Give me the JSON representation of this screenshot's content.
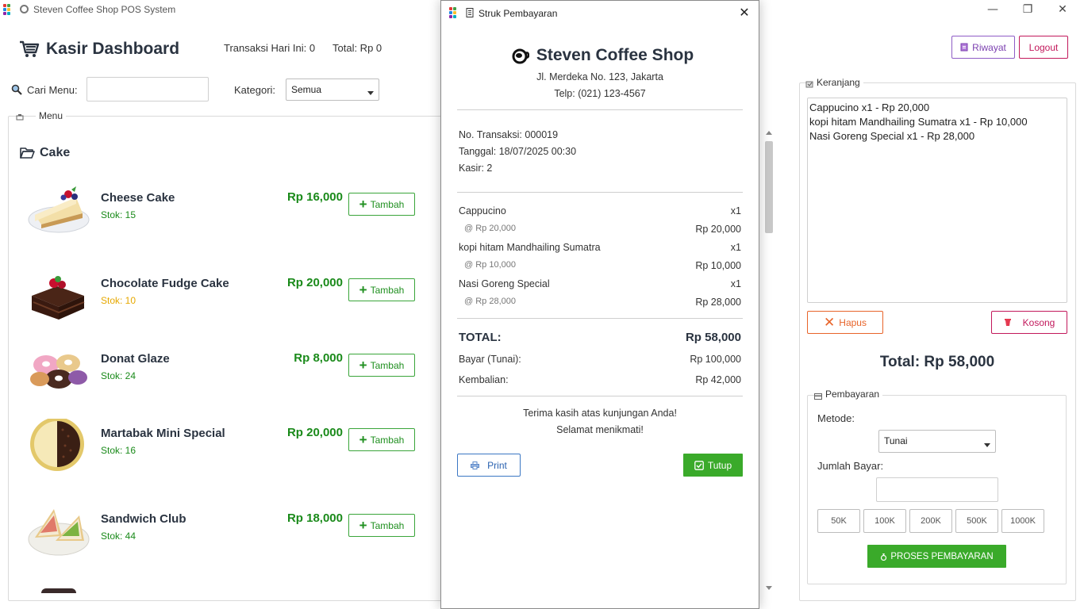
{
  "window": {
    "title": "Steven Coffee Shop POS System",
    "minimize_glyph": "—",
    "maximize_glyph": "❐",
    "close_glyph": "✕"
  },
  "header": {
    "title": "Kasir Dashboard",
    "transactions_today": "Transaksi Hari Ini: 0",
    "total_today": "Total: Rp 0",
    "history_button": "Riwayat",
    "logout_button": "Logout"
  },
  "search": {
    "label": "Cari Menu:",
    "value": "",
    "category_label": "Kategori:",
    "category_value": "Semua"
  },
  "menu": {
    "group_label": "Menu",
    "category_title": "Cake",
    "add_label": "Tambah",
    "items": [
      {
        "name": "Cheese Cake",
        "stock": "Stok: 15",
        "price": "Rp 16,000",
        "stock_color": "#1a8a1a"
      },
      {
        "name": "Chocolate Fudge Cake",
        "stock": "Stok: 10",
        "price": "Rp 20,000",
        "stock_color": "#e6a800"
      },
      {
        "name": "Donat Glaze",
        "stock": "Stok: 24",
        "price": "Rp 8,000",
        "stock_color": "#1a8a1a"
      },
      {
        "name": "Martabak Mini Special",
        "stock": "Stok: 16",
        "price": "Rp 20,000",
        "stock_color": "#1a8a1a"
      },
      {
        "name": "Sandwich Club",
        "stock": "Stok: 44",
        "price": "Rp 18,000",
        "stock_color": "#1a8a1a"
      }
    ]
  },
  "cart": {
    "group_label": "Keranjang",
    "items": [
      "Cappucino x1 - Rp 20,000",
      "kopi hitam Mandhailing Sumatra x1 - Rp 10,000",
      "Nasi Goreng Special x1 - Rp 28,000"
    ],
    "delete_button": "Hapus",
    "clear_button": "Kosong",
    "total": "Total: Rp 58,000"
  },
  "payment": {
    "group_label": "Pembayaran",
    "method_label": "Metode:",
    "method_value": "Tunai",
    "amount_label": "Jumlah Bayar:",
    "amount_value": "",
    "quick_amounts": [
      "50K",
      "100K",
      "200K",
      "500K",
      "1000K"
    ],
    "process_button": "PROSES PEMBAYARAN"
  },
  "receipt": {
    "title": "Struk Pembayaran",
    "close_glyph": "✕",
    "shop_name": "Steven Coffee Shop",
    "address": "Jl. Merdeka No. 123, Jakarta",
    "phone": "Telp: (021) 123-4567",
    "transaction_no": "No. Transaksi: 000019",
    "date": "Tanggal: 18/07/2025 00:30",
    "cashier": "Kasir: 2",
    "lines": [
      {
        "name": "Cappucino",
        "qty": "x1",
        "unit": "@ Rp 20,000",
        "subtotal": "Rp 20,000"
      },
      {
        "name": "kopi hitam Mandhailing Sumatra",
        "qty": "x1",
        "unit": "@ Rp 10,000",
        "subtotal": "Rp 10,000"
      },
      {
        "name": "Nasi Goreng Special",
        "qty": "x1",
        "unit": "@ Rp 28,000",
        "subtotal": "Rp 28,000"
      }
    ],
    "total_label": "TOTAL:",
    "total_value": "Rp 58,000",
    "paid_label": "Bayar (Tunai):",
    "paid_value": "Rp 100,000",
    "change_label": "Kembalian:",
    "change_value": "Rp 42,000",
    "thanks": "Terima kasih atas kunjungan Anda!",
    "enjoy": "Selamat menikmati!",
    "print_button": "Print",
    "close_button": "Tutup"
  },
  "colors": {
    "accent_green": "#3aaa2a",
    "price_green": "#1a8a1a",
    "logout_red": "#c2185b",
    "history_purple": "#7b3fb0",
    "delete_orange": "#e8642a",
    "print_blue": "#2a62b0",
    "title_dark": "#2a3340"
  }
}
